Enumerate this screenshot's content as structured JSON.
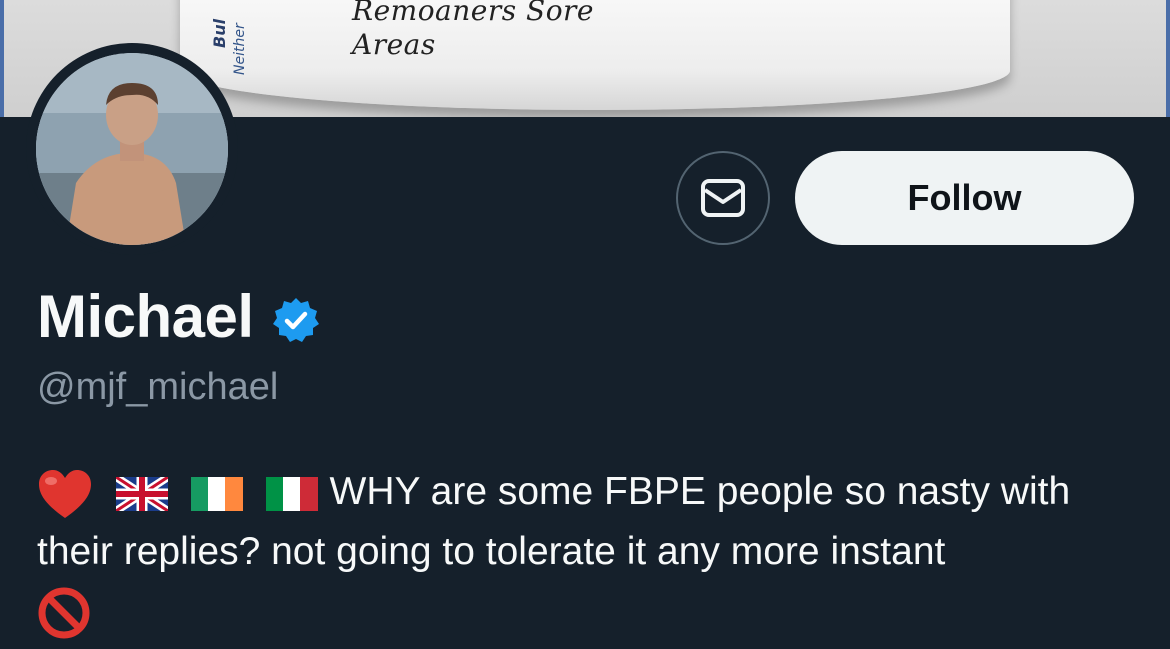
{
  "banner": {
    "tub_label_line1": "Remoaners Sore",
    "tub_label_line2": "Areas",
    "tub_side_text1": "Bul",
    "tub_side_text2": "Neither"
  },
  "profile": {
    "name": "Michael",
    "handle": "@mjf_michael",
    "verified": true,
    "bio_text": "WHY are some FBPE people so nasty with their replies? not going to tolerate it any more instant",
    "bio_emojis": [
      "red-heart",
      "uk-flag",
      "ireland-flag",
      "italy-flag",
      "no-entry"
    ]
  },
  "actions": {
    "follow_label": "Follow",
    "message_icon": "envelope-icon"
  },
  "colors": {
    "background": "#15202b",
    "verified_blue": "#1d9bf0",
    "follow_bg": "#eff3f4",
    "handle_gray": "#8b98a5"
  }
}
